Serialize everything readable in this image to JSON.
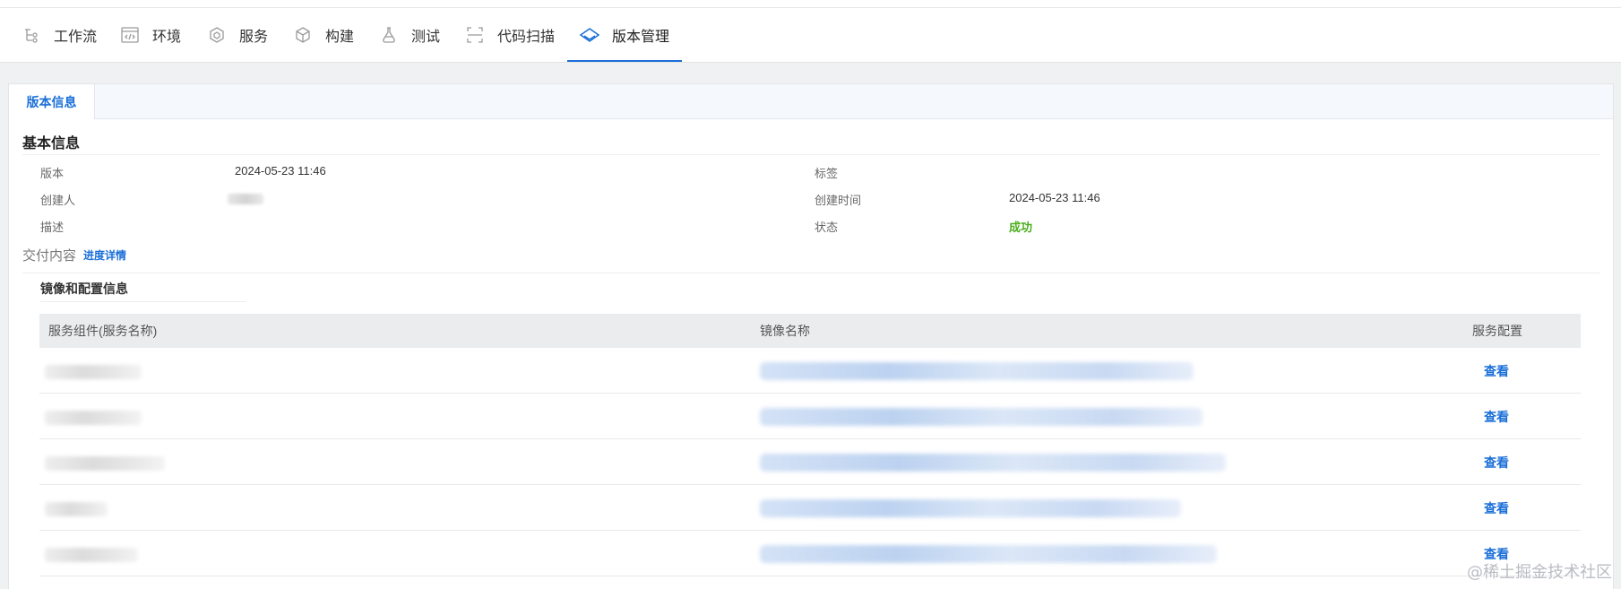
{
  "nav": {
    "items": [
      {
        "label": "工作流",
        "icon": "workflow-icon"
      },
      {
        "label": "环境",
        "icon": "code-window-icon"
      },
      {
        "label": "服务",
        "icon": "hexagon-icon"
      },
      {
        "label": "构建",
        "icon": "cube-icon"
      },
      {
        "label": "测试",
        "icon": "flask-icon"
      },
      {
        "label": "代码扫描",
        "icon": "scan-icon"
      },
      {
        "label": "版本管理",
        "icon": "diamond-icon"
      }
    ],
    "active_index": 6,
    "accent_color": "#1a6fd8"
  },
  "tabs": [
    {
      "label": "版本信息"
    }
  ],
  "basic": {
    "title": "基本信息",
    "version_label": "版本",
    "version_value": "2024-05-23 11:46",
    "creator_label": "创建人",
    "desc_label": "描述",
    "tag_label": "标签",
    "created_time_label": "创建时间",
    "created_time_value": "2024-05-23 11:46",
    "status_label": "状态",
    "status_value": "成功",
    "status_color": "#4caf1e"
  },
  "delivery": {
    "title": "交付内容",
    "detail_link": "进度详情",
    "subsection_title": "镜像和配置信息",
    "columns": [
      "服务组件(服务名称)",
      "镜像名称",
      "服务配置"
    ],
    "rows": [
      {
        "action": "查看"
      },
      {
        "action": "查看"
      },
      {
        "action": "查看"
      },
      {
        "action": "查看"
      },
      {
        "action": "查看"
      }
    ]
  },
  "watermark": "@稀土掘金技术社区"
}
